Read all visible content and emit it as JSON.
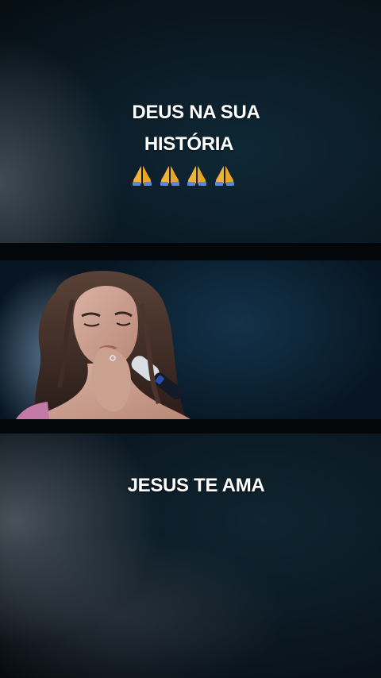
{
  "captions": {
    "top_line1": "DEUS NA SUA",
    "top_line2": "HISTÓRIA",
    "bottom": "JESUS TE AMA"
  },
  "emoji": {
    "name": "folded-hands-icon",
    "count": 4
  },
  "colors": {
    "background": "#05080c",
    "text": "#ffffff",
    "stage_blue": "#0c2233"
  }
}
